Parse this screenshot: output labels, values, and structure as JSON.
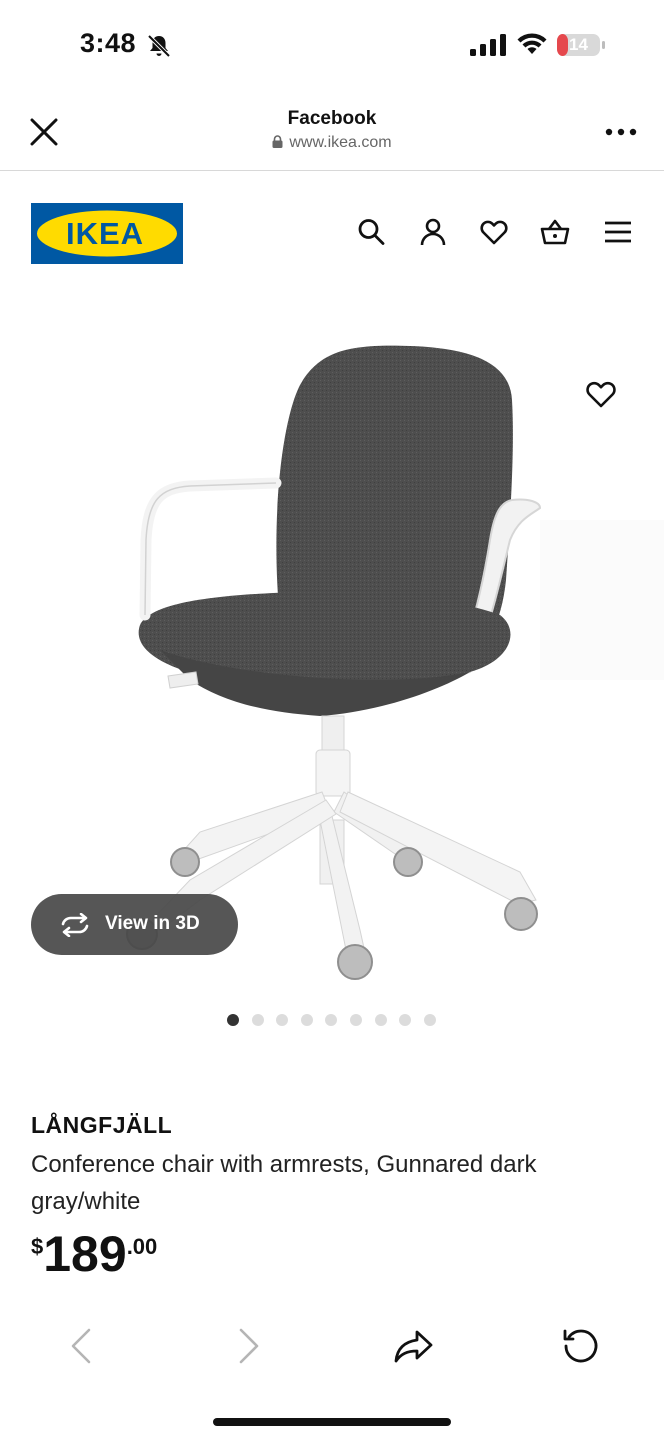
{
  "status_bar": {
    "time": "3:48",
    "battery": "14"
  },
  "browser": {
    "title": "Facebook",
    "url": "www.ikea.com"
  },
  "site": {
    "logo_text": "IKEA",
    "brand_colors": {
      "blue": "#0058a3",
      "yellow": "#ffdb00"
    },
    "nav_icons": [
      "search-icon",
      "account-icon",
      "heart-icon",
      "basket-icon",
      "menu-icon"
    ]
  },
  "gallery": {
    "view_3d_label": "View in 3D",
    "image_count": 9,
    "active_index": 0
  },
  "product": {
    "name": "LÅNGFJÄLL",
    "description": "Conference chair with armrests, Gunnared dark gray/white",
    "price_currency": "$",
    "price_integer": "189",
    "price_decimal": ".00"
  },
  "toolbar": {
    "icons": [
      "back-icon",
      "forward-icon",
      "share-icon",
      "reload-icon"
    ]
  }
}
